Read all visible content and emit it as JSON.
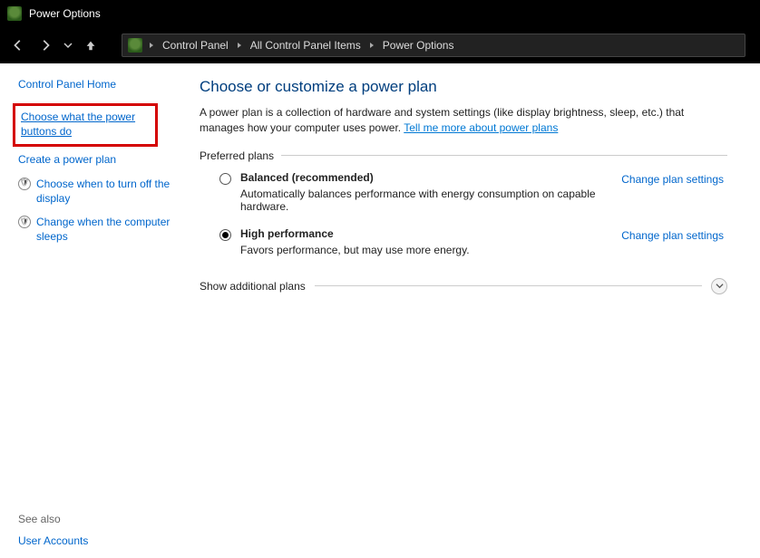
{
  "window": {
    "title": "Power Options"
  },
  "breadcrumbs": [
    "Control Panel",
    "All Control Panel Items",
    "Power Options"
  ],
  "sidebar": {
    "home": "Control Panel Home",
    "links": [
      {
        "label": "Choose what the power buttons do",
        "highlighted": true
      },
      {
        "label": "Create a power plan"
      },
      {
        "label": "Choose when to turn off the display"
      },
      {
        "label": "Change when the computer sleeps"
      }
    ],
    "see_also_label": "See also",
    "see_also": [
      "User Accounts"
    ]
  },
  "main": {
    "title": "Choose or customize a power plan",
    "description_prefix": "A power plan is a collection of hardware and system settings (like display brightness, sleep, etc.) that manages how your computer uses power. ",
    "learn_more": "Tell me more about power plans",
    "preferred_label": "Preferred plans",
    "plans": [
      {
        "name": "Balanced (recommended)",
        "desc": "Automatically balances performance with energy consumption on capable hardware.",
        "change": "Change plan settings",
        "selected": false
      },
      {
        "name": "High performance",
        "desc": "Favors performance, but may use more energy.",
        "change": "Change plan settings",
        "selected": true
      }
    ],
    "expander_label": "Show additional plans"
  }
}
